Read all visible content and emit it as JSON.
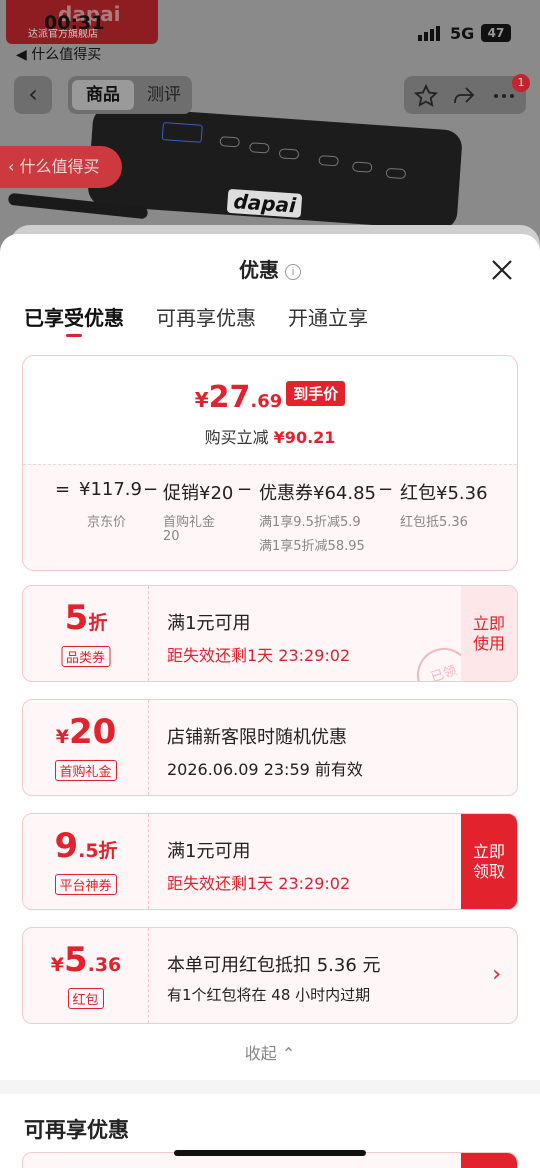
{
  "status_bar": {
    "time": "00:31",
    "network": "5G",
    "battery": "47",
    "back_app": "◀ 什么值得买"
  },
  "store": {
    "brand": "dapai",
    "name": "达派官方旗舰店"
  },
  "nav": {
    "tab_goods": "商品",
    "tab_review": "测评",
    "badge": "1"
  },
  "zdm_pill": "什么值得买",
  "sheet": {
    "title": "优惠",
    "tabs": [
      "已享受优惠",
      "可再享优惠",
      "开通立享"
    ],
    "summary": {
      "currency": "¥",
      "price_int": "27",
      "price_dec": ".69",
      "price_tag": "到手价",
      "reduce_label": "购买立减",
      "reduce_value": "¥90.21",
      "eq": "=",
      "jd_price": "¥117.9",
      "jd_price_label": "京东价",
      "minus": "−",
      "promo": "促销¥20",
      "promo_sub1": "首购礼金",
      "promo_sub2": "20",
      "coupon": "优惠券¥64.85",
      "coupon_sub1": "满1享9.5折减5.9",
      "coupon_sub2": "满1享5折减58.95",
      "redpacket": "红包¥5.36",
      "redpacket_sub": "红包抵5.36"
    },
    "cards": [
      {
        "val_main": "5",
        "val_suffix": "折",
        "label": "品类券",
        "line1": "满1元可用",
        "line2": "距失效还剩1天 23:29:02",
        "action": "立即使用",
        "stamp": "已领"
      },
      {
        "val_prefix": "¥",
        "val_main": "20",
        "label": "首购礼金",
        "line1": "店铺新客限时随机优惠",
        "line2": "2026.06.09 23:59 前有效"
      },
      {
        "val_main": "9",
        "val_suffix": ".5折",
        "label": "平台神券",
        "line1": "满1元可用",
        "line2": "距失效还剩1天 23:29:02",
        "action": "立即领取"
      },
      {
        "val_prefix": "¥",
        "val_main": "5",
        "val_suffix": ".36",
        "label": "红包",
        "line1": "本单可用红包抵扣 5.36 元",
        "line2": "有1个红包将在 48 小时内过期",
        "chevron": "›"
      }
    ],
    "collapse": "收起",
    "more_title": "可再享优惠"
  },
  "colors": {
    "accent": "#e2222c",
    "card_bg": "#fff6f7",
    "card_border": "#f6c9cc"
  }
}
